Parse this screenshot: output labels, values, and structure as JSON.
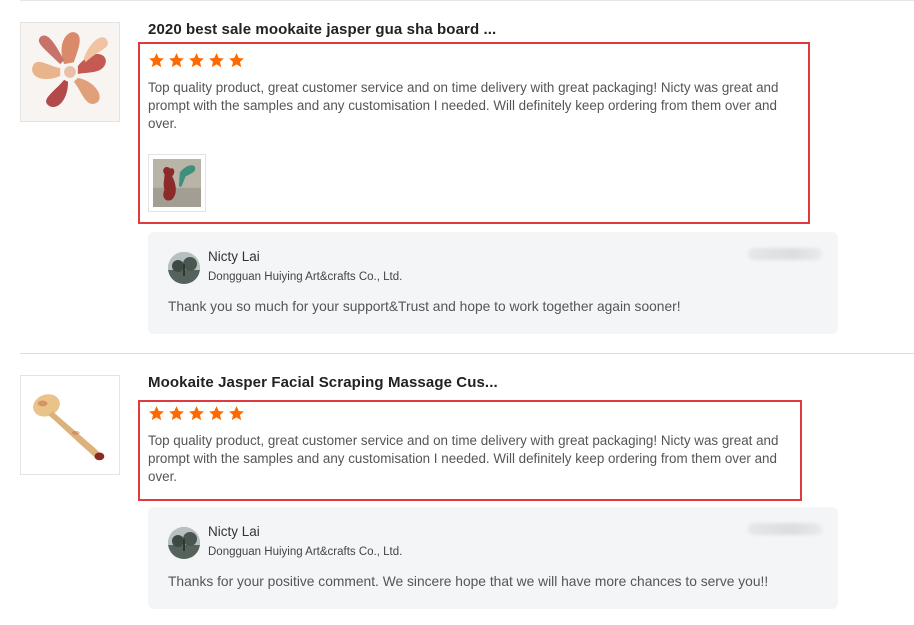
{
  "colors": {
    "star": "#ff6a00",
    "highlight_border": "#e0393e",
    "reply_background": "#f4f5f7"
  },
  "reviews": [
    {
      "product_title": "2020 best sale mookaite jasper gua sha board ...",
      "rating": 5,
      "review_text": "Top quality product, great customer service and on time delivery with great packaging! Nicty was great and prompt with the samples and any customisation I needed. Will definitely keep ordering from them over and over.",
      "has_photo": true,
      "reply": {
        "author": "Nicty Lai",
        "company": "Dongguan Huiying Art&crafts Co., Ltd.",
        "text": "Thank you so much for your support&Trust and hope to work together again sooner!"
      }
    },
    {
      "product_title": "Mookaite Jasper Facial Scraping Massage Cus...",
      "rating": 5,
      "review_text": "Top quality product, great customer service and on time delivery with great packaging! Nicty was great and prompt with the samples and any customisation I needed. Will definitely keep ordering from them over and over.",
      "has_photo": false,
      "reply": {
        "author": "Nicty Lai",
        "company": "Dongguan Huiying Art&crafts Co., Ltd.",
        "text": "Thanks for your positive comment. We sincere hope that we will have more chances to serve you!!"
      }
    }
  ]
}
